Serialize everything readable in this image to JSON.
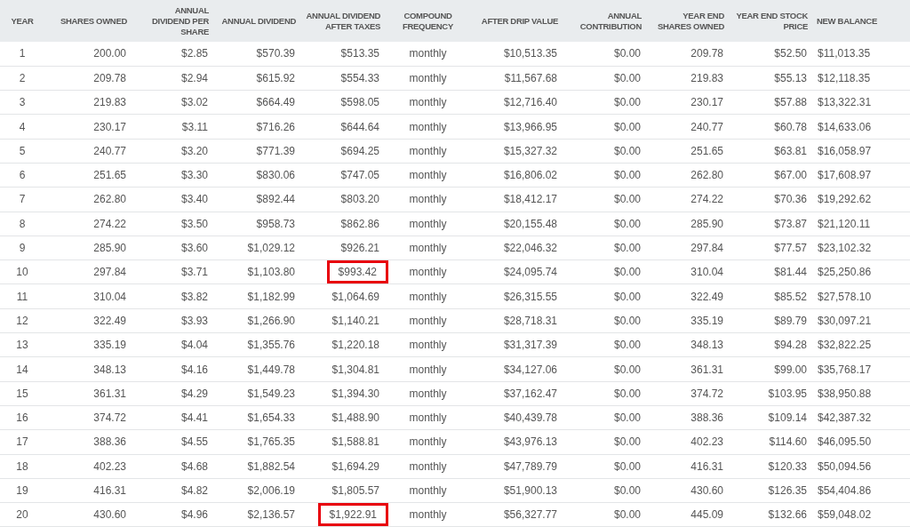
{
  "table": {
    "columns": [
      {
        "label": "YEAR"
      },
      {
        "label": "SHARES OWNED"
      },
      {
        "label": "ANNUAL DIVIDEND PER SHARE"
      },
      {
        "label": "ANNUAL DIVIDEND"
      },
      {
        "label": "ANNUAL DIVIDEND AFTER TAXES"
      },
      {
        "label": "COMPOUND FREQUENCY"
      },
      {
        "label": "AFTER DRIP VALUE"
      },
      {
        "label": "ANNUAL CONTRIBUTION"
      },
      {
        "label": "YEAR END SHARES OWNED"
      },
      {
        "label": "YEAR END STOCK PRICE"
      },
      {
        "label": "NEW BALANCE"
      }
    ],
    "rows": [
      {
        "cells": [
          "1",
          "200.00",
          "$2.85",
          "$570.39",
          "$513.35",
          "monthly",
          "$10,513.35",
          "$0.00",
          "209.78",
          "$52.50",
          "$11,013.35"
        ],
        "after_taxes_boxed": false
      },
      {
        "cells": [
          "2",
          "209.78",
          "$2.94",
          "$615.92",
          "$554.33",
          "monthly",
          "$11,567.68",
          "$0.00",
          "219.83",
          "$55.13",
          "$12,118.35"
        ],
        "after_taxes_boxed": false
      },
      {
        "cells": [
          "3",
          "219.83",
          "$3.02",
          "$664.49",
          "$598.05",
          "monthly",
          "$12,716.40",
          "$0.00",
          "230.17",
          "$57.88",
          "$13,322.31"
        ],
        "after_taxes_boxed": false
      },
      {
        "cells": [
          "4",
          "230.17",
          "$3.11",
          "$716.26",
          "$644.64",
          "monthly",
          "$13,966.95",
          "$0.00",
          "240.77",
          "$60.78",
          "$14,633.06"
        ],
        "after_taxes_boxed": false
      },
      {
        "cells": [
          "5",
          "240.77",
          "$3.20",
          "$771.39",
          "$694.25",
          "monthly",
          "$15,327.32",
          "$0.00",
          "251.65",
          "$63.81",
          "$16,058.97"
        ],
        "after_taxes_boxed": false
      },
      {
        "cells": [
          "6",
          "251.65",
          "$3.30",
          "$830.06",
          "$747.05",
          "monthly",
          "$16,806.02",
          "$0.00",
          "262.80",
          "$67.00",
          "$17,608.97"
        ],
        "after_taxes_boxed": false
      },
      {
        "cells": [
          "7",
          "262.80",
          "$3.40",
          "$892.44",
          "$803.20",
          "monthly",
          "$18,412.17",
          "$0.00",
          "274.22",
          "$70.36",
          "$19,292.62"
        ],
        "after_taxes_boxed": false
      },
      {
        "cells": [
          "8",
          "274.22",
          "$3.50",
          "$958.73",
          "$862.86",
          "monthly",
          "$20,155.48",
          "$0.00",
          "285.90",
          "$73.87",
          "$21,120.11"
        ],
        "after_taxes_boxed": false
      },
      {
        "cells": [
          "9",
          "285.90",
          "$3.60",
          "$1,029.12",
          "$926.21",
          "monthly",
          "$22,046.32",
          "$0.00",
          "297.84",
          "$77.57",
          "$23,102.32"
        ],
        "after_taxes_boxed": false
      },
      {
        "cells": [
          "10",
          "297.84",
          "$3.71",
          "$1,103.80",
          "$993.42",
          "monthly",
          "$24,095.74",
          "$0.00",
          "310.04",
          "$81.44",
          "$25,250.86"
        ],
        "after_taxes_boxed": true
      },
      {
        "cells": [
          "11",
          "310.04",
          "$3.82",
          "$1,182.99",
          "$1,064.69",
          "monthly",
          "$26,315.55",
          "$0.00",
          "322.49",
          "$85.52",
          "$27,578.10"
        ],
        "after_taxes_boxed": false
      },
      {
        "cells": [
          "12",
          "322.49",
          "$3.93",
          "$1,266.90",
          "$1,140.21",
          "monthly",
          "$28,718.31",
          "$0.00",
          "335.19",
          "$89.79",
          "$30,097.21"
        ],
        "after_taxes_boxed": false
      },
      {
        "cells": [
          "13",
          "335.19",
          "$4.04",
          "$1,355.76",
          "$1,220.18",
          "monthly",
          "$31,317.39",
          "$0.00",
          "348.13",
          "$94.28",
          "$32,822.25"
        ],
        "after_taxes_boxed": false
      },
      {
        "cells": [
          "14",
          "348.13",
          "$4.16",
          "$1,449.78",
          "$1,304.81",
          "monthly",
          "$34,127.06",
          "$0.00",
          "361.31",
          "$99.00",
          "$35,768.17"
        ],
        "after_taxes_boxed": false
      },
      {
        "cells": [
          "15",
          "361.31",
          "$4.29",
          "$1,549.23",
          "$1,394.30",
          "monthly",
          "$37,162.47",
          "$0.00",
          "374.72",
          "$103.95",
          "$38,950.88"
        ],
        "after_taxes_boxed": false
      },
      {
        "cells": [
          "16",
          "374.72",
          "$4.41",
          "$1,654.33",
          "$1,488.90",
          "monthly",
          "$40,439.78",
          "$0.00",
          "388.36",
          "$109.14",
          "$42,387.32"
        ],
        "after_taxes_boxed": false
      },
      {
        "cells": [
          "17",
          "388.36",
          "$4.55",
          "$1,765.35",
          "$1,588.81",
          "monthly",
          "$43,976.13",
          "$0.00",
          "402.23",
          "$114.60",
          "$46,095.50"
        ],
        "after_taxes_boxed": false
      },
      {
        "cells": [
          "18",
          "402.23",
          "$4.68",
          "$1,882.54",
          "$1,694.29",
          "monthly",
          "$47,789.79",
          "$0.00",
          "416.31",
          "$120.33",
          "$50,094.56"
        ],
        "after_taxes_boxed": false
      },
      {
        "cells": [
          "19",
          "416.31",
          "$4.82",
          "$2,006.19",
          "$1,805.57",
          "monthly",
          "$51,900.13",
          "$0.00",
          "430.60",
          "$126.35",
          "$54,404.86"
        ],
        "after_taxes_boxed": false
      },
      {
        "cells": [
          "20",
          "430.60",
          "$4.96",
          "$2,136.57",
          "$1,922.91",
          "monthly",
          "$56,327.77",
          "$0.00",
          "445.09",
          "$132.66",
          "$59,048.02"
        ],
        "after_taxes_boxed": true
      }
    ]
  }
}
